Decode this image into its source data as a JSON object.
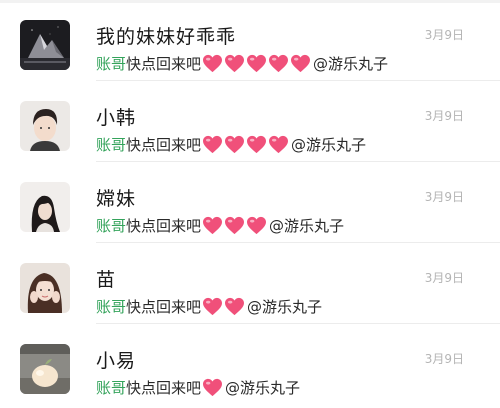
{
  "chats": [
    {
      "name": "我的妹妹好乖乖",
      "time": "3月9日",
      "sender": "账哥",
      "message": "快点回来吧",
      "heart_count": 5,
      "mention": "@游乐丸子",
      "avatar": "iceberg-night"
    },
    {
      "name": "小韩",
      "time": "3月9日",
      "sender": "账哥",
      "message": "快点回来吧",
      "heart_count": 4,
      "mention": "@游乐丸子",
      "avatar": "boy-portrait"
    },
    {
      "name": "嫦妹",
      "time": "3月9日",
      "sender": "账哥",
      "message": "快点回来吧",
      "heart_count": 3,
      "mention": "@游乐丸子",
      "avatar": "girl-long-hair"
    },
    {
      "name": "苗",
      "time": "3月9日",
      "sender": "账哥",
      "message": "快点回来吧",
      "heart_count": 2,
      "mention": "@游乐丸子",
      "avatar": "girl-with-hands"
    },
    {
      "name": "小易",
      "time": "3月9日",
      "sender": "账哥",
      "message": "快点回来吧",
      "heart_count": 1,
      "mention": "@游乐丸子",
      "avatar": "peach-lamp"
    }
  ],
  "colors": {
    "sender": "#34a35b",
    "heart": "#f0507a",
    "time": "#b4b4b4"
  },
  "icons": {
    "heart": "pink-heart-emoji"
  }
}
